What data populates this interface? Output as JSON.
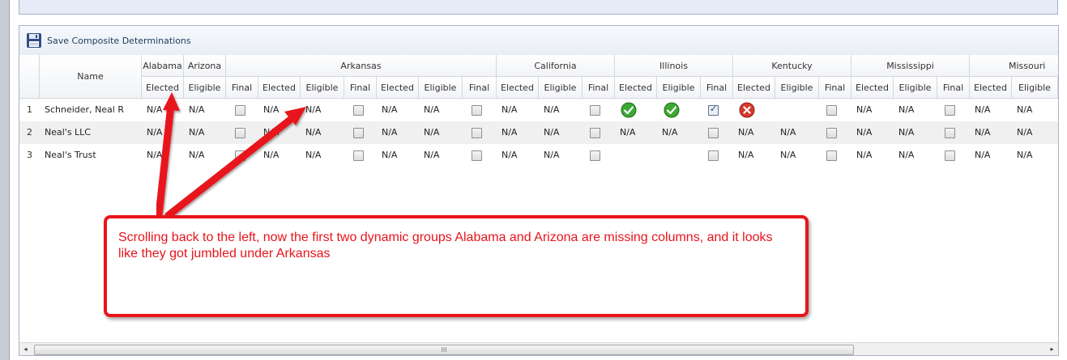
{
  "toolbar": {
    "save_label": "Save Composite Determinations",
    "save_icon": "floppy-disk-icon"
  },
  "header": {
    "name_label": "Name",
    "groups": [
      "Alabama",
      "Arizona",
      "Arkansas",
      "California",
      "Illinois",
      "Kentucky",
      "Mississippi",
      "Missouri"
    ],
    "subcols": {
      "elected": "Elected",
      "eligible": "Eligible",
      "final": "Final"
    }
  },
  "rows": [
    {
      "num": "1",
      "name": "Schneider, Neal R",
      "na": "N/A"
    },
    {
      "num": "2",
      "name": "Neal's LLC",
      "na": "N/A"
    },
    {
      "num": "3",
      "name": "Neal's Trust",
      "na": "N/A"
    }
  ],
  "status_icons": {
    "ok": "green-check-icon",
    "error": "red-x-icon"
  },
  "colors": {
    "annotation_red": "#e8141a",
    "header_border": "#d3d8df",
    "alt_row": "#f0f0f0"
  },
  "callout": {
    "text": "Scrolling back to the left, now the first two dynamic groups Alabama and Arizona are missing columns, and it looks like they got jumbled under Arkansas"
  },
  "scrollbar": {
    "grip": "III",
    "left_arrow": "◂",
    "right_arrow": "▸"
  }
}
